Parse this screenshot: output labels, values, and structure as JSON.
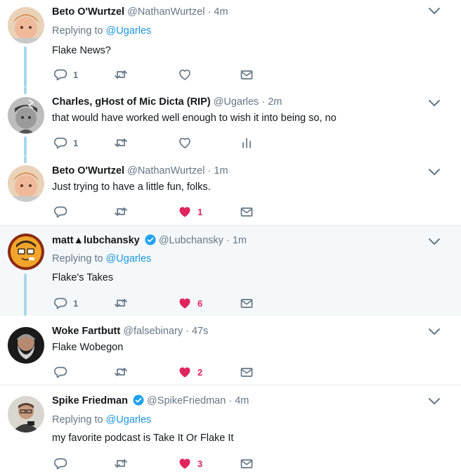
{
  "colors": {
    "accent": "#1b95e0",
    "like": "#e0245e",
    "muted": "#657786",
    "thread": "#a7d8ec",
    "highlight": "#f5f8fa"
  },
  "tweets": [
    {
      "name": "Beto O'Wurtzel",
      "handle": "@NathanWurtzel",
      "time": "4m",
      "replying_prefix": "Replying to",
      "replying_to": "@Ugarles",
      "text": "Flake News?",
      "reply_count": "1",
      "like_count": "",
      "liked": false,
      "last_action": "dm",
      "verified": false
    },
    {
      "name": "Charles, gHost of Mic Dicta (RIP)",
      "handle": "@Ugarles",
      "time": "2m",
      "text": "that would have worked well enough to wish it into being so, no",
      "reply_count": "1",
      "like_count": "",
      "liked": false,
      "last_action": "analytics",
      "verified": false
    },
    {
      "name": "Beto O'Wurtzel",
      "handle": "@NathanWurtzel",
      "time": "1m",
      "text": "Just trying to have a little fun, folks.",
      "reply_count": "",
      "like_count": "1",
      "liked": true,
      "last_action": "dm",
      "verified": false
    },
    {
      "name": "matt▲lubchansky",
      "handle": "@Lubchansky",
      "time": "1m",
      "replying_prefix": "Replying to",
      "replying_to": "@Ugarles",
      "text": "Flake's Takes",
      "reply_count": "1",
      "like_count": "6",
      "liked": true,
      "last_action": "dm",
      "verified": true
    },
    {
      "name": "Woke Fartbutt",
      "handle": "@falsebinary",
      "time": "47s",
      "text": "Flake Wobegon",
      "reply_count": "",
      "like_count": "2",
      "liked": true,
      "last_action": "dm",
      "verified": false
    },
    {
      "name": "Spike Friedman",
      "handle": "@SpikeFriedman",
      "time": "4m",
      "replying_prefix": "Replying to",
      "replying_to": "@Ugarles",
      "text": "my favorite podcast is Take It Or Flake It",
      "reply_count": "",
      "like_count": "3",
      "liked": true,
      "last_action": "dm",
      "verified": true
    }
  ],
  "dot": "·"
}
